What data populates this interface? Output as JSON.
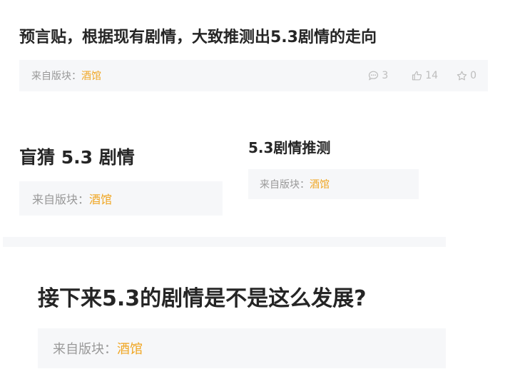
{
  "posts": [
    {
      "title": "预言贴，根据现有剧情，大致推测出5.3剧情的走向",
      "board_label": "来自版块：",
      "board": "酒馆",
      "stats": {
        "comments": "3",
        "likes": "14",
        "favorites": "0"
      }
    },
    {
      "title": "盲猜 5.3 剧情",
      "board_label": "来自版块：",
      "board": "酒馆"
    },
    {
      "title": "5.3剧情推测",
      "board_label": "来自版块：",
      "board": "酒馆"
    },
    {
      "title": "接下来5.3的剧情是不是这么发展?",
      "board_label": "来自版块：",
      "board": "酒馆"
    }
  ],
  "colors": {
    "board_link": "#f0a622",
    "meta_bg": "#f6f7f9",
    "muted_text": "#999999",
    "icon": "#bdbdbd"
  },
  "icons": [
    "comment-icon",
    "thumbs-up-icon",
    "star-icon"
  ]
}
